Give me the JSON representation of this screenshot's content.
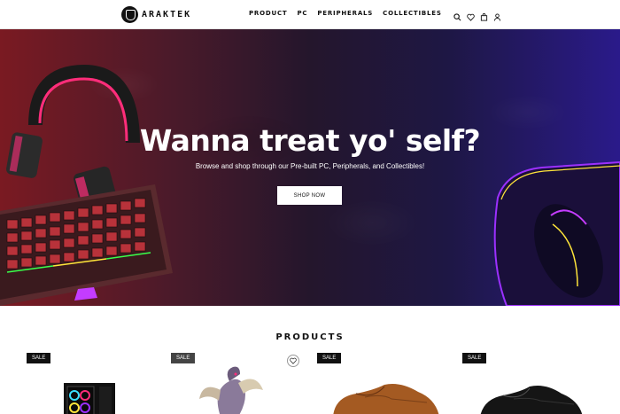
{
  "header": {
    "logo_text": "ARAKTEK",
    "nav": [
      {
        "label": "PRODUCT"
      },
      {
        "label": "PC"
      },
      {
        "label": "PERIPHERALS"
      },
      {
        "label": "COLLECTIBLES"
      }
    ],
    "icons": [
      "search-icon",
      "heart-icon",
      "bag-icon",
      "user-icon"
    ]
  },
  "hero": {
    "title": "Wanna treat yo' self?",
    "subtitle": "Browse and shop through our Pre-built PC, Peripherals, and Collectibles!",
    "button_label": "SHOP NOW"
  },
  "products": {
    "title": "PRODUCTS",
    "cards": [
      {
        "badge": "SALE",
        "image": "gaming-pc-image"
      },
      {
        "badge": "SALE",
        "image": "dragon-figure-image"
      },
      {
        "badge": "SALE",
        "image": "brown-shoe-image"
      },
      {
        "badge": "SALE",
        "image": "black-shoe-image"
      }
    ]
  },
  "colors": {
    "hero_left": "#7a1a22",
    "hero_right": "#2a1a8a",
    "accent_pink": "#ff2d7a",
    "accent_purple": "#9b30ff"
  }
}
